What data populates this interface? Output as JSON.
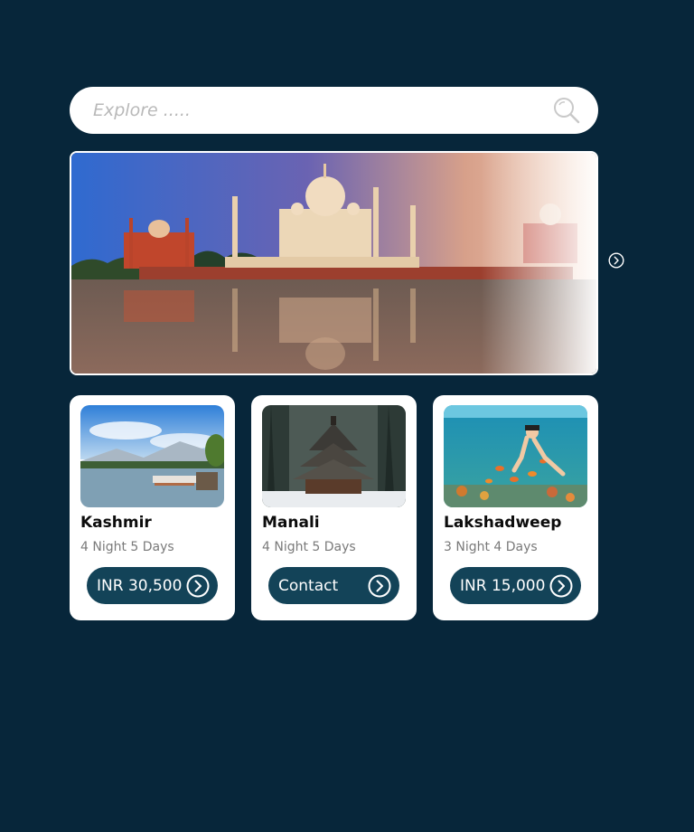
{
  "search": {
    "placeholder": "Explore .....",
    "icon": "search-icon"
  },
  "hero": {
    "image": "taj-mahal-banner",
    "next_icon": "chevron-right-circle-icon"
  },
  "colors": {
    "background": "#07263a",
    "card": "#ffffff",
    "button": "#134358"
  },
  "destinations": [
    {
      "title": "Kashmir",
      "duration": "4 Night 5 Days",
      "cta": "INR 30,500",
      "image": "kashmir-lake-photo"
    },
    {
      "title": "Manali",
      "duration": "4 Night 5 Days",
      "cta": "Contact",
      "image": "manali-temple-photo"
    },
    {
      "title": "Lakshadweep",
      "duration": "3 Night 4 Days",
      "cta": "INR 15,000",
      "image": "lakshadweep-snorkel-photo"
    }
  ]
}
